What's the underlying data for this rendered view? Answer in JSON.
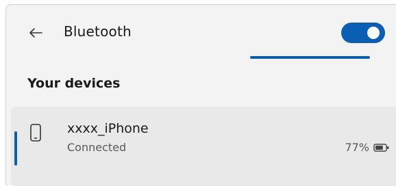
{
  "header": {
    "title": "Bluetooth",
    "back_icon": "arrow-left-icon",
    "bluetooth_on": true
  },
  "loading": {
    "progress": 0.82
  },
  "section": {
    "heading": "Your devices"
  },
  "devices": [
    {
      "name": "xxxx_iPhone",
      "status": "Connected",
      "battery": "77%",
      "battery_level": 0.77,
      "icon": "phone-icon"
    }
  ],
  "colors": {
    "accent": "#0a5fb4",
    "background": "#f3f3f3",
    "card": "#e9e9e9"
  }
}
